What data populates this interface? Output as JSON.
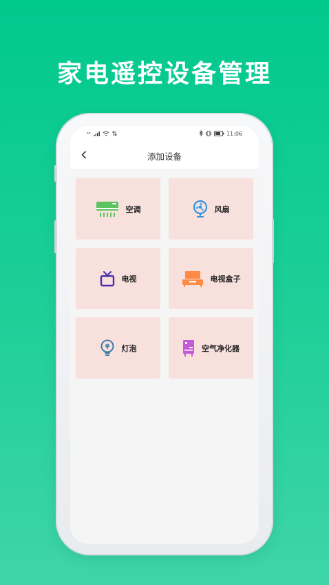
{
  "headline": "家电遥控设备管理",
  "status_bar": {
    "left_signal": "⁴⁶",
    "time": "11:06"
  },
  "nav": {
    "back_icon": "chevron-left-icon",
    "back_glyph": "‹",
    "title": "添加设备"
  },
  "devices": [
    {
      "label": "空调",
      "icon": "air-conditioner-icon",
      "color": "#5cc45e"
    },
    {
      "label": "风扇",
      "icon": "fan-icon",
      "color": "#2e8fd8"
    },
    {
      "label": "电视",
      "icon": "tv-icon",
      "color": "#4a2fa8"
    },
    {
      "label": "电视盒子",
      "icon": "tv-box-icon",
      "color": "#ff8a45"
    },
    {
      "label": "灯泡",
      "icon": "light-bulb-icon",
      "color": "#3e7ea8"
    },
    {
      "label": "空气净化器",
      "icon": "air-purifier-icon",
      "color": "#c55ad8"
    }
  ],
  "colors": {
    "background": "#1fcf98",
    "card": "#f8e0dd",
    "screen": "#f5f5f5"
  }
}
